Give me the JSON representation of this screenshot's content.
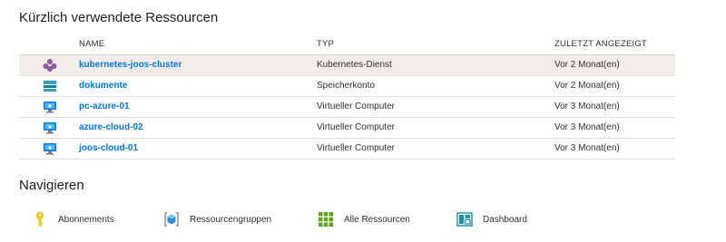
{
  "recent": {
    "title": "Kürzlich verwendete Ressourcen",
    "columns": {
      "name": "NAME",
      "type": "TYP",
      "last_viewed": "ZULETZT ANGEZEIGT"
    },
    "rows": [
      {
        "name": "kubernetes-joos-cluster",
        "type": "Kubernetes-Dienst",
        "last_viewed": "Vor 2 Monat(en)",
        "icon": "kubernetes-icon"
      },
      {
        "name": "dokumente",
        "type": "Speicherkonto",
        "last_viewed": "Vor 2 Monat(en)",
        "icon": "storage-account-icon"
      },
      {
        "name": "pc-azure-01",
        "type": "Virtueller Computer",
        "last_viewed": "Vor 3 Monat(en)",
        "icon": "virtual-machine-icon"
      },
      {
        "name": "azure-cloud-02",
        "type": "Virtueller Computer",
        "last_viewed": "Vor 3 Monat(en)",
        "icon": "virtual-machine-icon"
      },
      {
        "name": "joos-cloud-01",
        "type": "Virtueller Computer",
        "last_viewed": "Vor 3 Monat(en)",
        "icon": "virtual-machine-icon"
      }
    ]
  },
  "navigate": {
    "title": "Navigieren",
    "items": [
      {
        "label": "Abonnements",
        "icon": "key-icon"
      },
      {
        "label": "Ressourcengruppen",
        "icon": "resource-group-icon"
      },
      {
        "label": "Alle Ressourcen",
        "icon": "all-resources-icon"
      },
      {
        "label": "Dashboard",
        "icon": "dashboard-icon"
      }
    ]
  },
  "colors": {
    "link": "#0078d4",
    "selected_row": "#f3ecea",
    "grid_green": "#5ea51b",
    "key_yellow": "#f2c811"
  }
}
